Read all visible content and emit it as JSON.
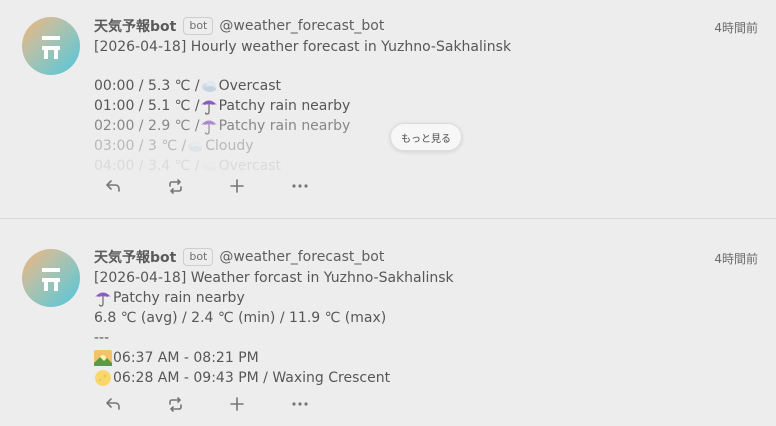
{
  "notes": [
    {
      "author": {
        "display_name": "天気予報bot",
        "badge": "bot",
        "username": "@weather_forecast_bot"
      },
      "time": "4時間前",
      "content": {
        "title": "[2026-04-18] Hourly weather forecast in Yuzhno-Sakhalinsk",
        "hours": [
          {
            "text": "00:00 / 5.3 ℃ / ",
            "icon": "cloud-icon",
            "condition": "Overcast"
          },
          {
            "text": "01:00 / 5.1 ℃ / ",
            "icon": "umbrella-icon",
            "condition": "Patchy rain nearby"
          },
          {
            "text": "02:00 / 2.9 ℃ / ",
            "icon": "umbrella-icon",
            "condition": "Patchy rain nearby"
          },
          {
            "text": "03:00 / 3 ℃ / ",
            "icon": "cloud-icon",
            "condition": "Cloudy"
          },
          {
            "text": "04:00 / 3.4 ℃ / ",
            "icon": "cloud-icon",
            "condition": "Overcast"
          }
        ]
      },
      "show_more_label": "もっと見る"
    },
    {
      "author": {
        "display_name": "天気予報bot",
        "badge": "bot",
        "username": "@weather_forecast_bot"
      },
      "time": "4時間前",
      "content": {
        "title": "[2026-04-18] Weather forcast in Yuzhno-Sakhalinsk",
        "condition": "Patchy rain nearby",
        "condition_icon": "umbrella-icon",
        "temps": "6.8 ℃ (avg) / 2.4 ℃ (min) / 11.9 ℃ (max)",
        "separator": "---",
        "sun": "06:37 AM - 08:21 PM",
        "sun_icon": "sunrise-icon",
        "moon": "06:28 AM - 09:43 PM / Waxing Crescent",
        "moon_icon": "moon-icon"
      }
    }
  ],
  "actions": [
    "reply-icon",
    "renote-icon",
    "plus-icon",
    "more-icon"
  ],
  "colors": {
    "background": "#eeedee",
    "text": "#5c5c5c",
    "umbrella": "#8c5bbf",
    "avatar_gradient": [
      "#f2b27a",
      "#4fc7dc"
    ]
  }
}
